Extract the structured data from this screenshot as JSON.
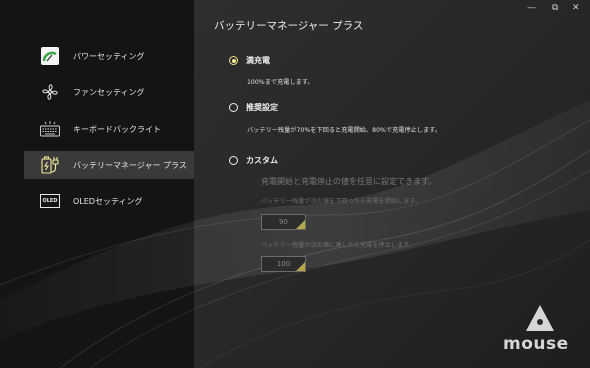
{
  "app": {
    "page_title": "バッテリーマネージャー プラス",
    "brand": "mouse"
  },
  "window": {
    "min_glyph": "—",
    "max_glyph": "⧉",
    "close_glyph": "✕"
  },
  "sidebar": {
    "items": [
      {
        "label": "パワーセッティング",
        "icon": "power-gauge-icon",
        "active": false
      },
      {
        "label": "ファンセッティング",
        "icon": "fan-icon",
        "active": false
      },
      {
        "label": "キーボードバックライト",
        "icon": "keyboard-backlight-icon",
        "active": false
      },
      {
        "label": "バッテリーマネージャー プラス",
        "icon": "battery-plug-icon",
        "active": true
      },
      {
        "label": "OLEDセッティング",
        "icon": "oled-icon",
        "icon_text": "OLED",
        "active": false
      }
    ]
  },
  "options": {
    "full": {
      "label": "満充電",
      "desc": "100%まで充電します。",
      "selected": true
    },
    "recommended": {
      "label": "推奨設定",
      "desc": "バッテリー残量が70%を下回ると充電開始、80%で充電停止します。",
      "selected": false
    },
    "custom": {
      "label": "カスタム",
      "selected": false,
      "desc": "充電開始と充電停止の値を任意に設定できます。",
      "start_label": "バッテリー残量が次の値を下回ったら充電を開始します。",
      "start_value": "90",
      "stop_label": "バッテリー残量が次の値に達したら充電を停止します。",
      "stop_value": "100"
    }
  },
  "colors": {
    "accent": "#f4ec9c",
    "sidebar_bg": "#141414",
    "main_bg": "#2a2a2a",
    "active_item_bg": "#3a3a3a"
  }
}
